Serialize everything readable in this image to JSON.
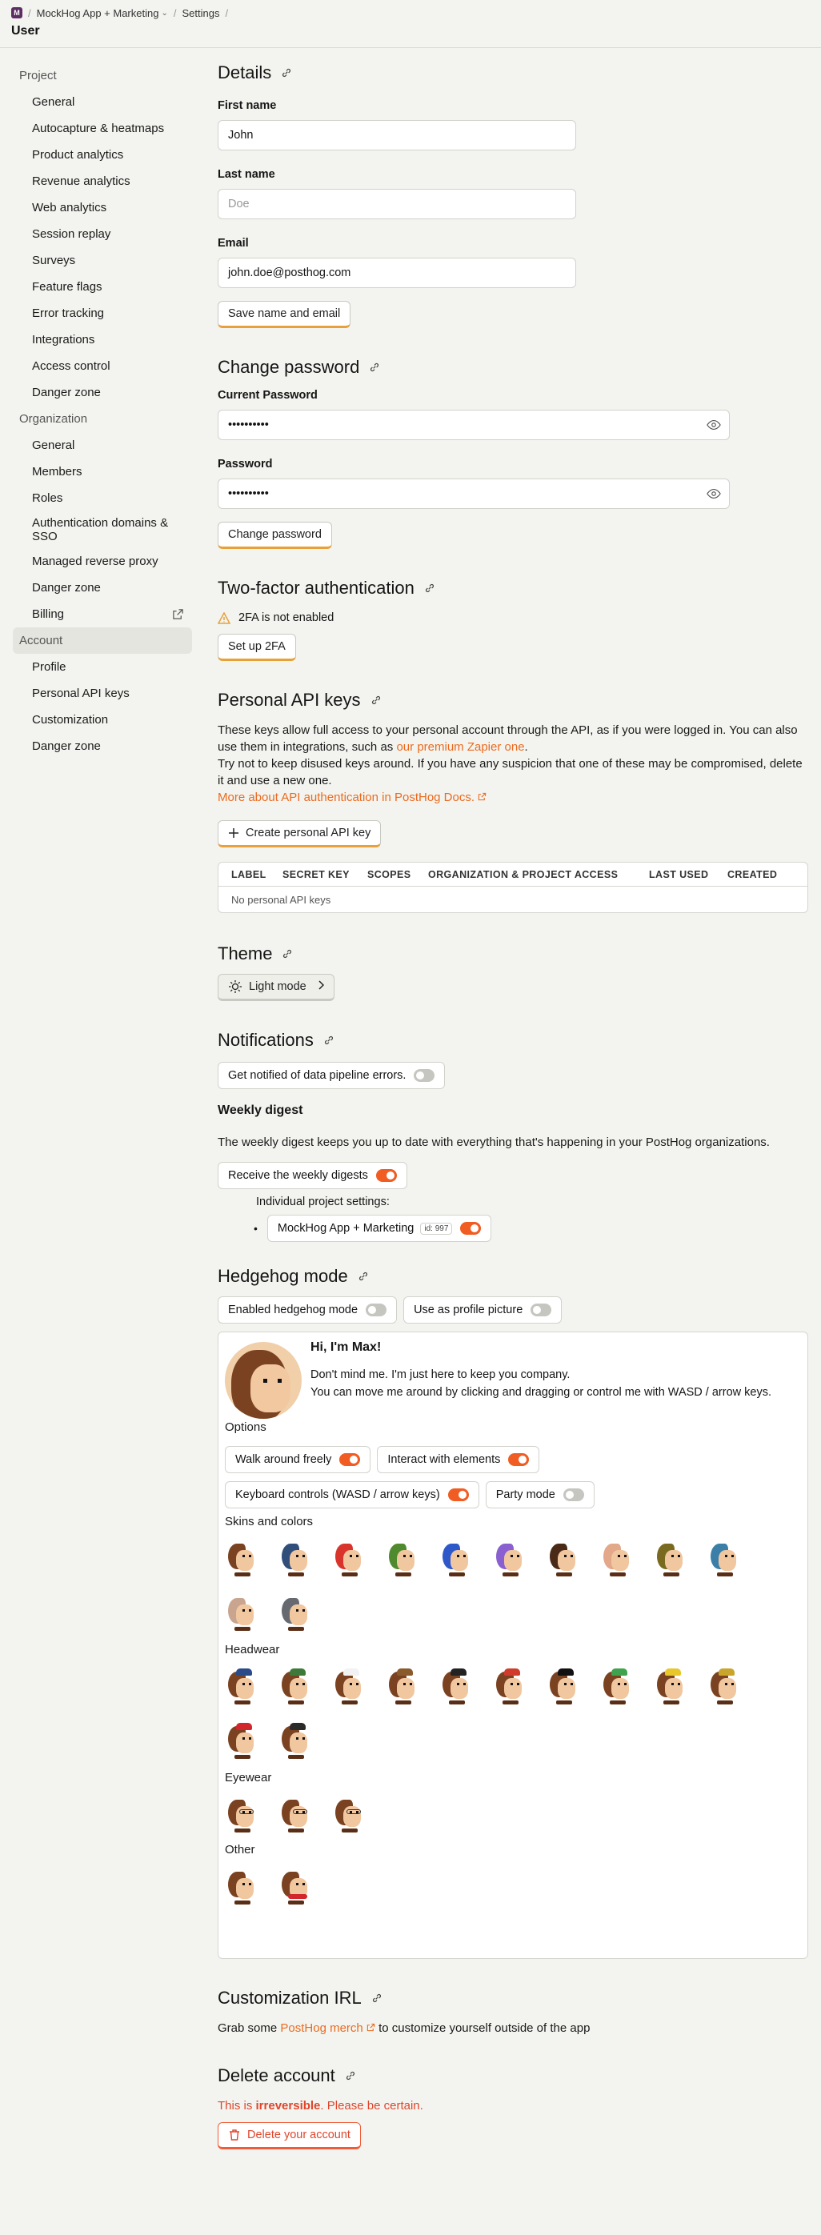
{
  "breadcrumb": {
    "logo": "M",
    "project": "MockHog App + Marketing",
    "settings": "Settings"
  },
  "page_title": "User",
  "sidebar": {
    "project_header": "Project",
    "project_items": [
      "General",
      "Autocapture & heatmaps",
      "Product analytics",
      "Revenue analytics",
      "Web analytics",
      "Session replay",
      "Surveys",
      "Feature flags",
      "Error tracking",
      "Integrations",
      "Access control",
      "Danger zone"
    ],
    "org_header": "Organization",
    "org_items": [
      "General",
      "Members",
      "Roles",
      "Authentication domains & SSO",
      "Managed reverse proxy",
      "Danger zone",
      "Billing"
    ],
    "account_header": "Account",
    "account_items": [
      "Profile",
      "Personal API keys",
      "Customization",
      "Danger zone"
    ]
  },
  "details": {
    "title": "Details",
    "first_name_label": "First name",
    "first_name_value": "John",
    "last_name_label": "Last name",
    "last_name_placeholder": "Doe",
    "email_label": "Email",
    "email_value": "john.doe@posthog.com",
    "save_button": "Save name and email"
  },
  "password": {
    "title": "Change password",
    "current_label": "Current Password",
    "current_value": "••••••••••",
    "new_label": "Password",
    "new_value": "••••••••••",
    "button": "Change password"
  },
  "twofa": {
    "title": "Two-factor authentication",
    "status": "2FA is not enabled",
    "button": "Set up 2FA"
  },
  "api_keys": {
    "title": "Personal API keys",
    "desc_1": "These keys allow full access to your personal account through the API, as if you were logged in. You can also use them in integrations, such as",
    "desc_link": "our premium Zapier one",
    "desc_2": "Try not to keep disused keys around. If you have any suspicion that one of these may be compromised, delete it and use a new one.",
    "docs_link": "More about API authentication in PostHog Docs.",
    "create_button": "Create personal API key",
    "columns": [
      "LABEL",
      "SECRET KEY",
      "SCOPES",
      "ORGANIZATION & PROJECT ACCESS",
      "LAST USED",
      "CREATED"
    ],
    "empty": "No personal API keys"
  },
  "theme": {
    "title": "Theme",
    "value": "Light mode"
  },
  "notifications": {
    "title": "Notifications",
    "pipeline_label": "Get notified of data pipeline errors.",
    "pipeline_on": false,
    "weekly_title": "Weekly digest",
    "weekly_desc": "The weekly digest keeps you up to date with everything that's happening in your PostHog organizations.",
    "weekly_label": "Receive the weekly digests",
    "weekly_on": true,
    "individual_label": "Individual project settings:",
    "project_name": "MockHog App + Marketing",
    "project_id": "id: 997",
    "project_on": true
  },
  "hedgehog": {
    "title": "Hedgehog mode",
    "enabled_label": "Enabled hedgehog mode",
    "enabled_on": false,
    "profile_label": "Use as profile picture",
    "profile_on": false,
    "greeting": "Hi, I'm Max!",
    "line1": "Don't mind me. I'm just here to keep you company.",
    "line2": "You can move me around by clicking and dragging or control me with WASD / arrow keys.",
    "options_label": "Options",
    "walk_label": "Walk around freely",
    "walk_on": true,
    "interact_label": "Interact with elements",
    "interact_on": true,
    "keyboard_label": "Keyboard controls (WASD / arrow keys)",
    "keyboard_on": true,
    "party_label": "Party mode",
    "party_on": false,
    "skins_label": "Skins and colors",
    "skins": [
      "default",
      "spiderhog",
      "red",
      "green",
      "blue",
      "purple",
      "dark",
      "light",
      "sepia",
      "invert",
      "ghost",
      "robohog"
    ],
    "headwear_label": "Headwear",
    "headwear": [
      "beret",
      "cap",
      "chef",
      "cowboy",
      "eyepatch",
      "flag",
      "graduation",
      "parrot",
      "party",
      "pineapple",
      "santa",
      "tophat"
    ],
    "eyewear_label": "Eyewear",
    "eyewear": [
      "glasses",
      "sunglasses",
      "eyepatch"
    ],
    "other_label": "Other",
    "other": [
      "none",
      "scarf"
    ]
  },
  "customization": {
    "title": "Customization IRL",
    "prefix": "Grab some",
    "link": "PostHog merch",
    "suffix": "to customize yourself outside of the app"
  },
  "delete": {
    "title": "Delete account",
    "prefix": "This is",
    "bold": "irreversible",
    "suffix": ". Please be certain.",
    "button": "Delete your account"
  },
  "colors": {
    "accent": "#f05c22",
    "link": "#eb6a20",
    "danger": "#e0452b",
    "button_underline": "#e8a13a",
    "background": "#f3f4ef"
  }
}
